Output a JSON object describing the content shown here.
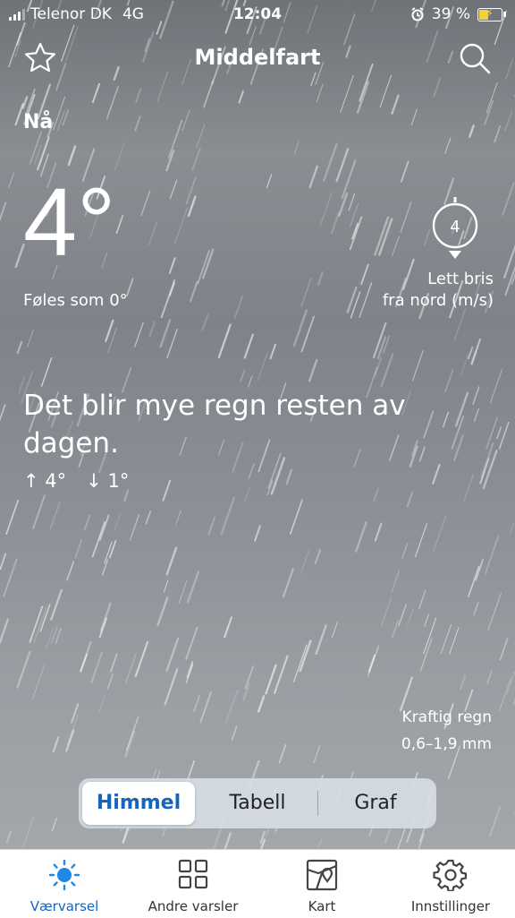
{
  "status": {
    "carrier": "Telenor DK",
    "network": "4G",
    "time": "12:04",
    "battery": "39 %"
  },
  "header": {
    "title": "Middelfart"
  },
  "current": {
    "label": "Nå",
    "temperature": "4°",
    "feels_like": "Føles som 0°",
    "wind_speed": "4",
    "wind_line1": "Lett bris",
    "wind_line2": "fra nord (m/s)"
  },
  "summary": {
    "text": "Det blir mye regn resten av dagen.",
    "high": "4°",
    "low": "1°"
  },
  "precip": {
    "line1": "Kraftig regn",
    "line2": "0,6–1,9 mm"
  },
  "segments": [
    {
      "label": "Himmel",
      "active": true
    },
    {
      "label": "Tabell",
      "active": false
    },
    {
      "label": "Graf",
      "active": false
    }
  ],
  "tabs": [
    {
      "label": "Værvarsel",
      "icon": "sun-icon",
      "active": true
    },
    {
      "label": "Andre varsler",
      "icon": "grid-icon"
    },
    {
      "label": "Kart",
      "icon": "map-icon"
    },
    {
      "label": "Innstillinger",
      "icon": "gear-icon"
    }
  ],
  "colors": {
    "accent": "#1565c0",
    "battery": "#f4d03f"
  }
}
